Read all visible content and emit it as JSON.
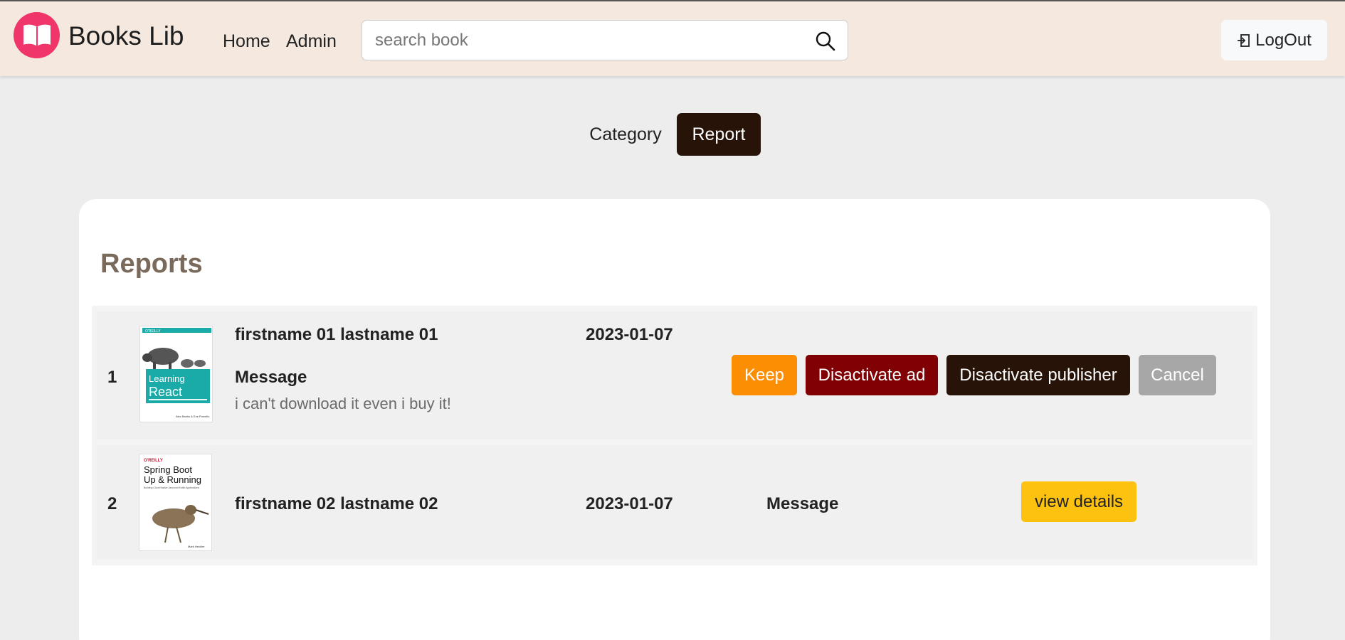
{
  "header": {
    "brand": "Books Lib",
    "nav": [
      {
        "label": "Home"
      },
      {
        "label": "Admin"
      }
    ],
    "search": {
      "placeholder": "search book",
      "value": ""
    },
    "logout_label": "LogOut"
  },
  "tabs": [
    {
      "label": "Category",
      "active": false
    },
    {
      "label": "Report",
      "active": true
    }
  ],
  "reports": {
    "title": "Reports",
    "rows": [
      {
        "index": "1",
        "name": "firstname 01 lastname 01",
        "date": "2023-01-07",
        "message_label": "Message",
        "message": "i can't download it even i buy it!",
        "cover": {
          "publisher": "O'REILLY",
          "title_line1": "Learning",
          "title_line2": "React",
          "authors": "Alex Banks & Eve Porcello"
        },
        "actions": {
          "keep": "Keep",
          "disable_ad": "Disactivate ad",
          "disable_publisher": "Disactivate publisher",
          "cancel": "Cancel"
        }
      },
      {
        "index": "2",
        "name": "firstname 02 lastname 02",
        "date": "2023-01-07",
        "message_label": "Message",
        "cover": {
          "publisher": "O'REILLY",
          "title_line1": "Spring Boot",
          "title_line2": "Up & Running",
          "subtitle": "Building Cloud Native Java and Kotlin Applications",
          "authors": "Mark Heckler"
        },
        "actions": {
          "view_details": "view details"
        }
      }
    ]
  },
  "colors": {
    "header_bg": "#f4e8df",
    "brand_logo": "#f0356b",
    "active_tab": "#271307",
    "keep": "#fc8e03",
    "disable_ad": "#810004",
    "disable_publisher": "#271307",
    "cancel": "#a7a7a7",
    "view_details": "#fdc20f"
  }
}
